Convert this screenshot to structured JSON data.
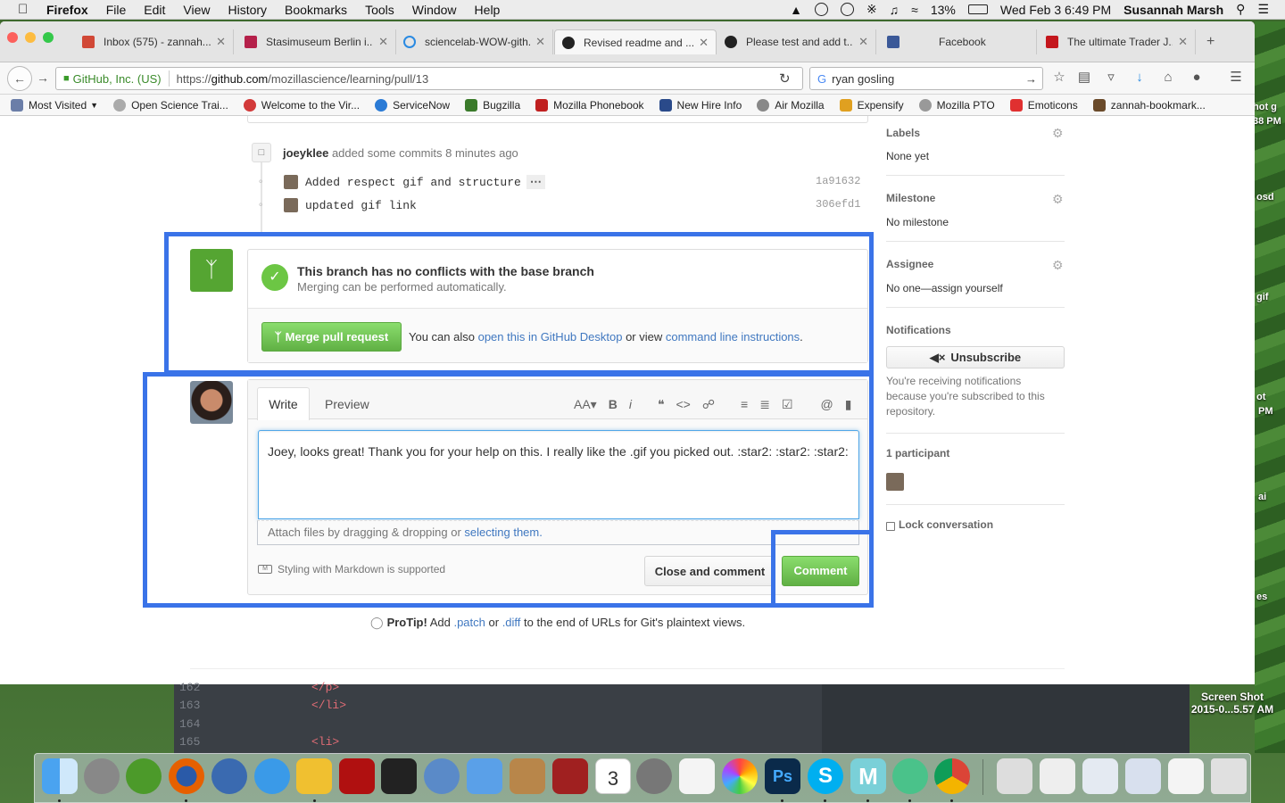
{
  "menubar": {
    "app": "Firefox",
    "items": [
      "File",
      "Edit",
      "View",
      "History",
      "Bookmarks",
      "Tools",
      "Window",
      "Help"
    ],
    "battery": "13%",
    "datetime": "Wed Feb 3  6:49 PM",
    "user": "Susannah Marsh"
  },
  "tabs": [
    {
      "title": "Inbox (575) - zannah...",
      "color": "#d14836"
    },
    {
      "title": "Stasimuseum Berlin i...",
      "color": "#b5204a"
    },
    {
      "title": "sciencelab-WOW-gith...",
      "color": "#2a8ae2"
    },
    {
      "title": "Revised readme and ...",
      "color": "#222222"
    },
    {
      "title": "Please test and add t...",
      "color": "#222222"
    },
    {
      "title": "Facebook",
      "color": "#3b5998"
    },
    {
      "title": "The ultimate Trader J...",
      "color": "#c4171d"
    }
  ],
  "navbar": {
    "org": "GitHub, Inc. (US)",
    "url_prefix": "https://",
    "url_host": "github.com",
    "url_path": "/mozillascience/learning/pull/13",
    "search_value": "ryan gosling"
  },
  "bookmarks": [
    {
      "label": "Most Visited",
      "color": "#6b7ea8"
    },
    {
      "label": "Open Science Trai...",
      "color": "#aaaaaa"
    },
    {
      "label": "Welcome to the Vir...",
      "color": "#d23a3a"
    },
    {
      "label": "ServiceNow",
      "color": "#2b7bd6"
    },
    {
      "label": "Bugzilla",
      "color": "#3a7a2a"
    },
    {
      "label": "Mozilla Phonebook",
      "color": "#c02020"
    },
    {
      "label": "New Hire Info",
      "color": "#2a4a8a"
    },
    {
      "label": "Air Mozilla",
      "color": "#888888"
    },
    {
      "label": "Expensify",
      "color": "#e0a020"
    },
    {
      "label": "Mozilla PTO",
      "color": "#999999"
    },
    {
      "label": "Emoticons",
      "color": "#e03030"
    },
    {
      "label": "zannah-bookmark...",
      "color": "#6a4a2a"
    }
  ],
  "timeline": {
    "author": "joeyklee",
    "action": "added some commits 8 minutes ago",
    "commits": [
      {
        "message": "Added respect gif and structure",
        "sha": "1a91632",
        "ellipsis": "⋯"
      },
      {
        "message": "updated gif link",
        "sha": "306efd1"
      }
    ]
  },
  "merge": {
    "title": "This branch has no conflicts with the base branch",
    "subtitle": "Merging can be performed automatically.",
    "button": "Merge pull request",
    "text1": "You can also ",
    "link1": "open this in GitHub Desktop",
    "text2": " or view ",
    "link2": "command line instructions",
    "text3": "."
  },
  "comment": {
    "tab_write": "Write",
    "tab_preview": "Preview",
    "text": "Joey, looks great! Thank you for your help on this. I really like the .gif you picked out. :star2: :star2: :star2:",
    "attach_text": "Attach files by dragging & dropping or ",
    "attach_link": "selecting them.",
    "markdown_note": "Styling with Markdown is supported",
    "close_button": "Close and comment",
    "comment_button": "Comment"
  },
  "protip": {
    "label": "ProTip!",
    "t1": " Add ",
    "patch": ".patch",
    "t2": " or ",
    "diff": ".diff",
    "t3": " to the end of URLs for Git's plaintext views."
  },
  "sidebar": {
    "labels_head": "Labels",
    "labels_val": "None yet",
    "milestone_head": "Milestone",
    "milestone_val": "No milestone",
    "assignee_head": "Assignee",
    "assignee_val": "No one—assign yourself",
    "notif_head": "Notifications",
    "unsubscribe": "Unsubscribe",
    "notif_text": "You're receiving notifications because you're subscribed to this repository.",
    "participants_head": "1 participant",
    "lock": "Lock conversation"
  },
  "editor": {
    "lines": [
      {
        "n": "162",
        "code": "  </p>"
      },
      {
        "n": "163",
        "code": "</li>"
      },
      {
        "n": "164",
        "code": ""
      },
      {
        "n": "165",
        "code": "<li>"
      }
    ]
  },
  "desktop": {
    "labels": [
      "hot g",
      "38 PM",
      "osd",
      "gif",
      "ot",
      "PM",
      "ai",
      "es"
    ],
    "screenshot_label_1": "Screen Shot",
    "screenshot_label_2": "2015-0...5.57 AM"
  },
  "accent": "#3a73e8"
}
